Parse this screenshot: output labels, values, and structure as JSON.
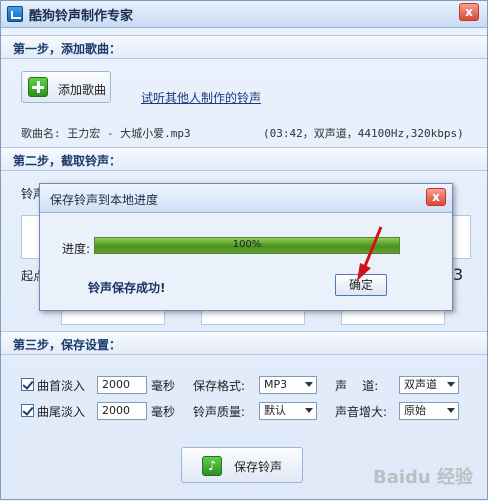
{
  "window": {
    "title": "酷狗铃声制作专家",
    "close_glyph": "x",
    "icon": "app-icon"
  },
  "step1": {
    "heading": "第一步，添加歌曲：",
    "add_song_label": "添加歌曲",
    "add_song_icon": "plus-icon",
    "link_text": "试听其他人制作的铃声",
    "song_name": "歌曲名: 王力宏 - 大城小爱.mp3",
    "song_detail": "(03:42，双声道，44100Hz,320kbps)"
  },
  "step2": {
    "heading": "第二步，截取铃声：",
    "ringtone_label_partial": "铃声",
    "start_label_partial": "起点",
    "digit_partial": "3"
  },
  "dialog": {
    "title": "保存铃声到本地进度",
    "close_glyph": "x",
    "progress_label": "进度:",
    "progress_value": 1.0,
    "progress_text": "100%",
    "success_message": "铃声保存成功!",
    "ok_label": "确定"
  },
  "step3": {
    "heading": "第三步，保存设置：",
    "fade_in_label": "曲首淡入",
    "fade_in_value": "2000",
    "fade_out_label": "曲尾淡入",
    "fade_out_value": "2000",
    "ms_unit": "毫秒",
    "format_label": "保存格式:",
    "format_value": "MP3",
    "quality_label": "铃声质量:",
    "quality_value": "默认",
    "channel_label": "声    道:",
    "channel_value": "双声道",
    "volume_label": "声音增大:",
    "volume_value": "原始",
    "save_label": "保存铃声",
    "save_icon": "music-note-icon"
  },
  "watermark": "Baidu 经验",
  "colors": {
    "accent": "#1b3a6b",
    "progress": "#4b9222",
    "close": "#d54b36",
    "arrow": "#d0141a"
  }
}
